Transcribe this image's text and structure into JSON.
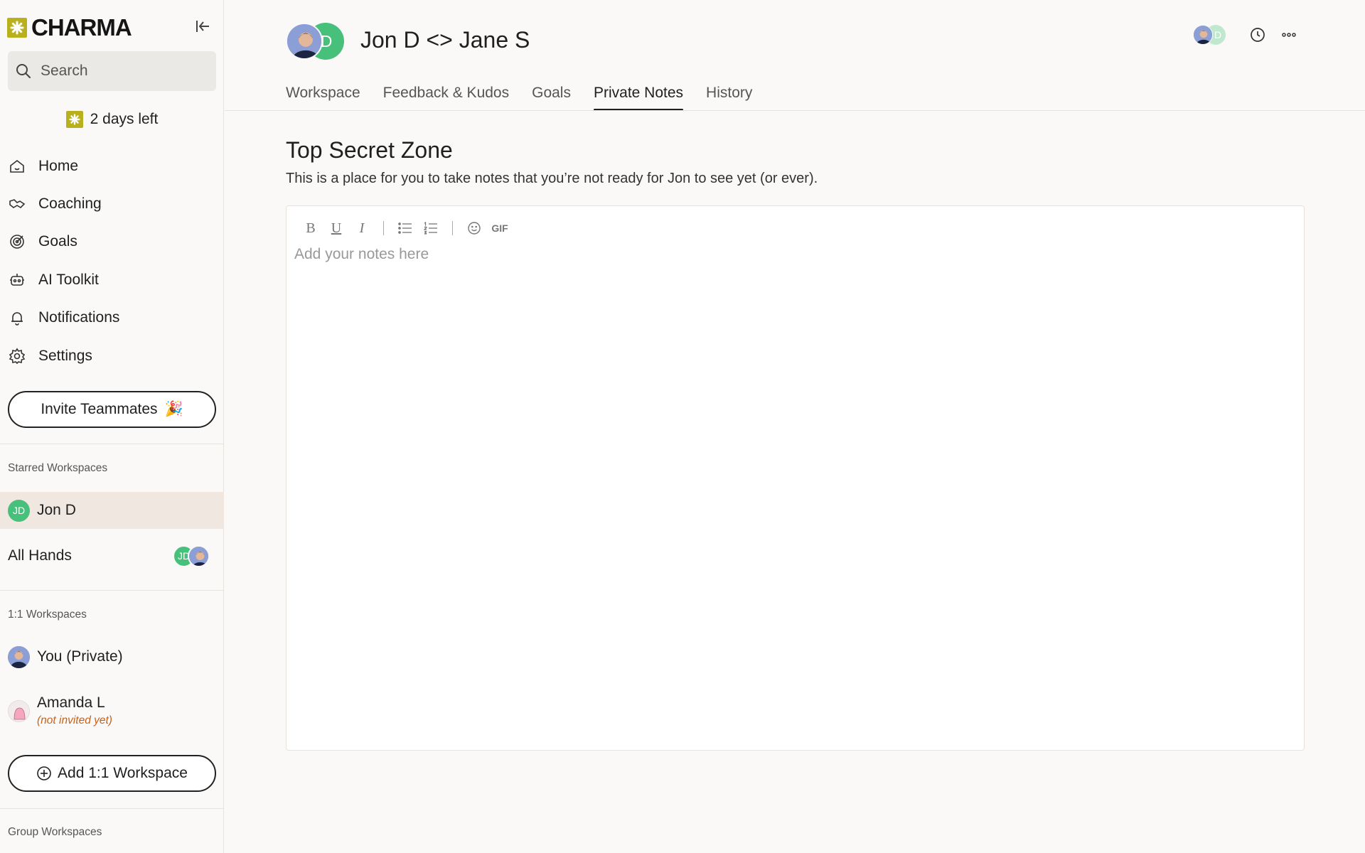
{
  "app": {
    "brand": "CHARMA"
  },
  "sidebar": {
    "search": {
      "placeholder": "Search"
    },
    "trial": "2 days left",
    "nav": [
      {
        "label": "Home",
        "icon": "home-icon"
      },
      {
        "label": "Coaching",
        "icon": "coaching-icon"
      },
      {
        "label": "Goals",
        "icon": "target-icon"
      },
      {
        "label": "AI Toolkit",
        "icon": "robot-icon"
      },
      {
        "label": "Notifications",
        "icon": "bell-icon"
      },
      {
        "label": "Settings",
        "icon": "gear-icon"
      }
    ],
    "invite": {
      "label": "Invite Teammates",
      "emoji": "🎉"
    },
    "starred": {
      "label": "Starred Workspaces",
      "items": [
        {
          "label": "Jon D",
          "initials": "JD"
        },
        {
          "label": "All Hands",
          "initials": "JD"
        }
      ]
    },
    "one_on_one": {
      "label": "1:1 Workspaces",
      "items": [
        {
          "label": "You (Private)"
        },
        {
          "label": "Amanda L",
          "note": "(not invited yet)"
        }
      ],
      "add_label": "Add 1:1 Workspace"
    },
    "group": {
      "label": "Group Workspaces"
    }
  },
  "main": {
    "header": {
      "title": "Jon D <> Jane S",
      "avatar_initial": "D",
      "mini_initial": "D"
    },
    "tabs": [
      "Workspace",
      "Feedback & Kudos",
      "Goals",
      "Private Notes",
      "History"
    ],
    "active_tab": "Private Notes",
    "zone": {
      "title": "Top Secret Zone",
      "description": "This is a place for you to take notes that you’re not ready for Jon to see yet (or ever)."
    },
    "editor": {
      "toolbar": {
        "bold": "B",
        "underline": "U",
        "italic": "I",
        "gif": "GIF"
      },
      "placeholder": "Add your notes here"
    }
  },
  "colors": {
    "accent": "#b8b11c",
    "avatar_green": "#46c07a",
    "active_row": "#efe7e0",
    "note_orange": "#c4621c"
  }
}
